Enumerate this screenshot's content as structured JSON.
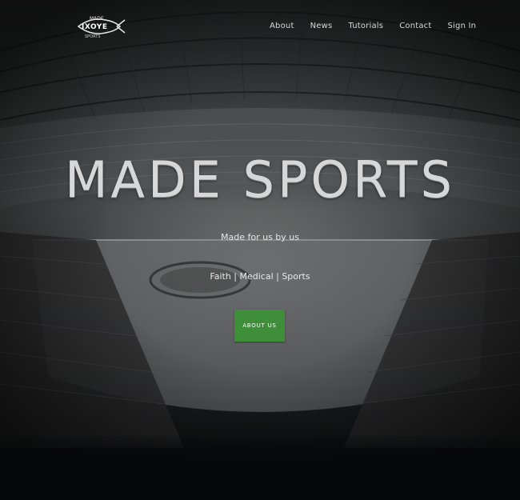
{
  "brand": {
    "logo_icon": "made-sports-fish-logo",
    "logo_top_text": "MADE",
    "logo_bottom_text": "SPORTS"
  },
  "nav": {
    "items": [
      {
        "label": "About"
      },
      {
        "label": "News"
      },
      {
        "label": "Tutorials"
      },
      {
        "label": "Contact"
      },
      {
        "label": "Sign In"
      }
    ]
  },
  "hero": {
    "title": "MADE SPORTS",
    "tagline": "Made for us by us",
    "subline": "Faith | Medical | Sports",
    "cta_label": "ABOUT US",
    "background_image": "arena-interior-photo"
  },
  "colors": {
    "cta": "#3f8f3a",
    "text": "#e6e6e6",
    "background": "#0b0c0d"
  }
}
